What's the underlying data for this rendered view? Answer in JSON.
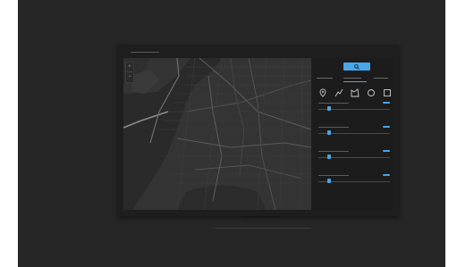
{
  "app": {
    "title": ""
  },
  "map": {
    "zoom_in": "+",
    "zoom_out": "−"
  },
  "panel": {
    "search_icon": "search-icon",
    "tabs": [
      {
        "label": "",
        "active": false
      },
      {
        "label": "",
        "active": true
      },
      {
        "label": "",
        "active": false
      }
    ],
    "tools": [
      "map-pin-icon",
      "polyline-icon",
      "polygon-icon",
      "circle-icon",
      "rectangle-icon"
    ],
    "layers": [
      {
        "name": "",
        "enabled": true,
        "value": 0.15
      },
      {
        "name": "",
        "enabled": true,
        "value": 0.15
      },
      {
        "name": "",
        "enabled": true,
        "value": 0.15
      },
      {
        "name": "",
        "enabled": true,
        "value": 0.15
      }
    ]
  },
  "colors": {
    "accent": "#49a6e8",
    "map_land": "#343434",
    "map_water": "#2a2a2a",
    "panel_bg": "#1c1c1c"
  }
}
